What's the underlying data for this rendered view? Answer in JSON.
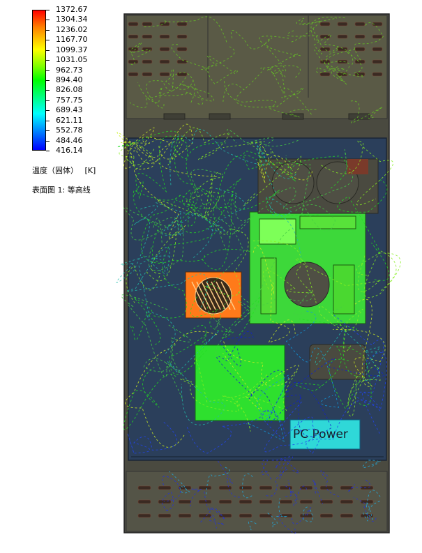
{
  "legend": {
    "ticks": [
      "1372.67",
      "1304.34",
      "1236.02",
      "1167.70",
      "1099.37",
      "1031.05",
      "962.73",
      "894.40",
      "826.08",
      "757.75",
      "689.43",
      "621.11",
      "552.78",
      "484.46",
      "416.14"
    ],
    "quantity": "温度（固体）",
    "unit": "[K]",
    "plot_name": "表面图 1: 等高线"
  },
  "labels": {
    "pc_power": "PC Power"
  },
  "colors": {
    "cabinet": "#2b3f5b",
    "top_panel": "#5a5a46",
    "bottom_panel": "#545447",
    "heatsink": "#44ee22",
    "hot_fan": "#ff7a1a",
    "pc_power_fill": "#2fd8d8"
  }
}
